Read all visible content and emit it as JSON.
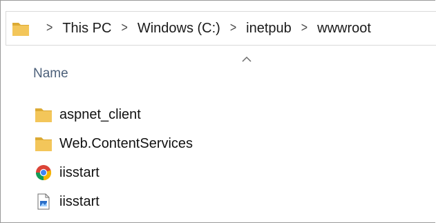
{
  "breadcrumb": {
    "items": [
      "This PC",
      "Windows (C:)",
      "inetpub",
      "wwwroot"
    ]
  },
  "columns": {
    "name_header": "Name"
  },
  "files": [
    {
      "name": "aspnet_client",
      "icon": "folder-icon"
    },
    {
      "name": "Web.ContentServices",
      "icon": "folder-icon"
    },
    {
      "name": "iisstart",
      "icon": "chrome-html-icon"
    },
    {
      "name": "iisstart",
      "icon": "image-file-icon"
    }
  ],
  "colors": {
    "folder": "#f3c65a",
    "folder_dark": "#dcaa34",
    "header_text": "#4c607a"
  }
}
